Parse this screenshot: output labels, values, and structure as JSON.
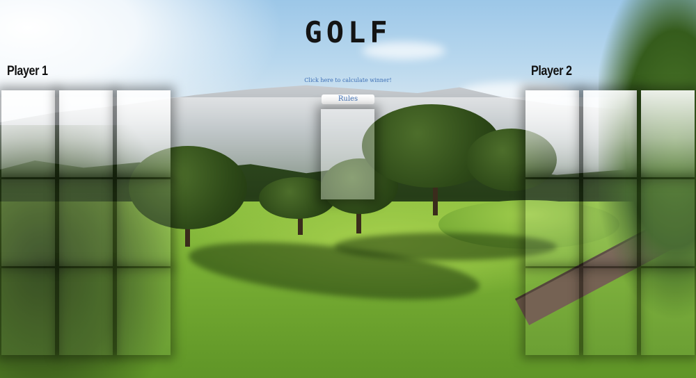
{
  "game": {
    "title": "GOLF",
    "calculate_link": "Click here to calculate winner!",
    "rules_label": "Rules"
  },
  "players": [
    {
      "label": "Player 1",
      "cards": [
        "",
        "",
        "",
        "",
        "",
        "",
        "",
        "",
        ""
      ]
    },
    {
      "label": "Player 2",
      "cards": [
        "",
        "",
        "",
        "",
        "",
        "",
        "",
        "",
        ""
      ]
    }
  ],
  "deck": {
    "state": "face-down"
  },
  "background": {
    "scene": "golf-course"
  }
}
